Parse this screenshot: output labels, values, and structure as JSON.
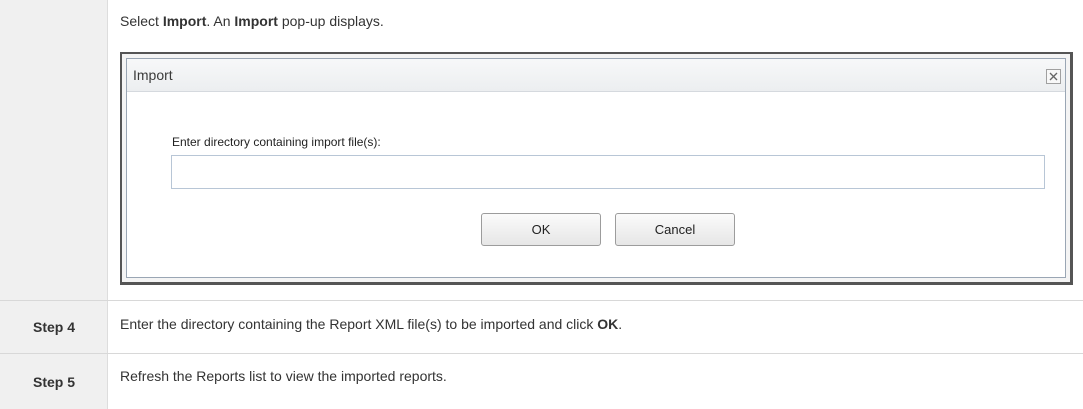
{
  "rows": {
    "intro": {
      "text_parts": [
        "Select ",
        "Import",
        ". An ",
        "Import",
        " pop-up displays."
      ]
    },
    "step4": {
      "label": "Step 4",
      "text_parts": [
        "Enter the directory containing the Report XML file(s) to be imported and click ",
        "OK",
        "."
      ]
    },
    "step5": {
      "label": "Step 5",
      "text": "Refresh the Reports list to view the imported reports."
    }
  },
  "dialog": {
    "title": "Import",
    "close_icon": "close-icon",
    "field_label": "Enter directory containing import file(s):",
    "field_value": "",
    "ok_label": "OK",
    "cancel_label": "Cancel"
  },
  "colors": {
    "step_cell_bg": "#f0f0f0",
    "text": "#333333",
    "dialog_border": "#555555",
    "input_border": "#b8c6d6"
  }
}
